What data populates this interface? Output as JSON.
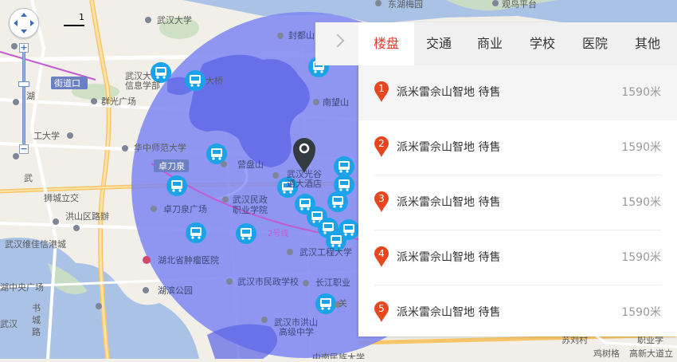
{
  "map": {
    "labels": {
      "wuhan_university": "武汉大学",
      "donghu_meiyuan": "东湖梅园",
      "guanyu_pingtai": "观鸟平台",
      "fengdu_station": "封都山",
      "daqiao": "大桥",
      "jiedaokou": "街道口",
      "wuhan_info_1": "武汉大",
      "wuhan_info_2": "信息学部",
      "nanwangshan": "南望山",
      "qunguang": "群光广场",
      "hu": "湖",
      "zhongdi_1": "工大学",
      "huazhong_normal": "华中师范大学",
      "yingpanshan": "营盘山",
      "zhuodaoquan_tag": "卓刀泉",
      "guanggu_1": "武汉光谷",
      "guanggu_2": "通大酒店",
      "wu": "武",
      "shichengli": "狮城立交",
      "hongshan_road": "洪山区路辦",
      "zhuodaoquan_plaza": "卓刀泉广场",
      "wuhan_minzheng_1": "武汉民政",
      "wuhan_minzheng_2": "职业学院",
      "wuhan_weixing": "武汉维佳信港城",
      "line2": "2号线",
      "hubei_tumor": "湖北省肿瘤医院",
      "wuhan_gongcheng": "武汉工程大学",
      "huibin_park": "湖滨公园",
      "minzheng_school": "武汉市民政学校",
      "changjiang_zhiye": "长江职业",
      "hongshan_high_1": "武汉市洪山",
      "hongshan_high_2": "高级中学",
      "hu_zhongguang": "湖中央广场",
      "shucheng_1": "书",
      "shucheng_2": "城",
      "shucheng_3": "路",
      "wuhan_l": "武汉",
      "suliu": "苏刘村",
      "zhiye_xue": "职业学",
      "jishu": "鸡树格",
      "gaoxin": "高新大道立",
      "guan": "关",
      "zhongnan": "中南民族大学",
      "scale": "1"
    }
  },
  "panel": {
    "tabs": [
      "楼盘",
      "交通",
      "商业",
      "学校",
      "医院",
      "其他"
    ],
    "active_tab": "楼盘",
    "items": [
      {
        "num": "1",
        "name": "派米雷佘山智地 待售",
        "dist": "1590米"
      },
      {
        "num": "2",
        "name": "派米雷佘山智地 待售",
        "dist": "1590米"
      },
      {
        "num": "3",
        "name": "派米雷佘山智地 待售",
        "dist": "1590米"
      },
      {
        "num": "4",
        "name": "派米雷佘山智地 待售",
        "dist": "1590米"
      },
      {
        "num": "5",
        "name": "派米雷佘山智地 待售",
        "dist": "1590米"
      }
    ]
  },
  "colors": {
    "radius_fill": "#7c86f2",
    "bus_icon": "#1aa3e8",
    "active_tab": "#e4392c",
    "pin": "#e8461f",
    "water": "#a9c2e6"
  }
}
